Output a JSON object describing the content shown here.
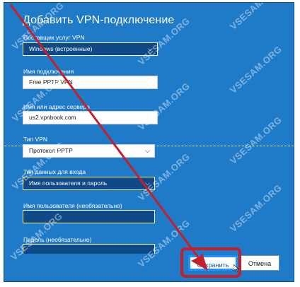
{
  "dialog": {
    "title": "Добавить VPN-подключение",
    "provider_label": "Поставщик услуг VPN",
    "provider_value": "Windows (встроенные)",
    "connection_name_label": "Имя подключения",
    "connection_name_value": "Free PPTP VPN",
    "server_label": "Имя или адрес сервера",
    "server_value": "us2.vpnbook.com",
    "vpn_type_label": "Тип VPN",
    "vpn_type_value": "Протокол PPTP",
    "signin_type_label": "Тип данных для входа",
    "signin_type_value": "Имя пользователя и пароль",
    "username_label": "Имя пользователя (необязательно)",
    "username_value": "",
    "password_label": "Пароль (необязательно)",
    "password_value": ""
  },
  "buttons": {
    "save_label": "Сохранить",
    "cancel_label": "Отмена"
  },
  "watermark": "VSESAM.ORG",
  "colors": {
    "background": "#1f7ac8",
    "annotation_red": "#c4202c",
    "save_border": "#1e90ff"
  },
  "icons": [
    "chevron-down-icon",
    "red-arrow-annotation",
    "mouse-pointer-icon"
  ]
}
